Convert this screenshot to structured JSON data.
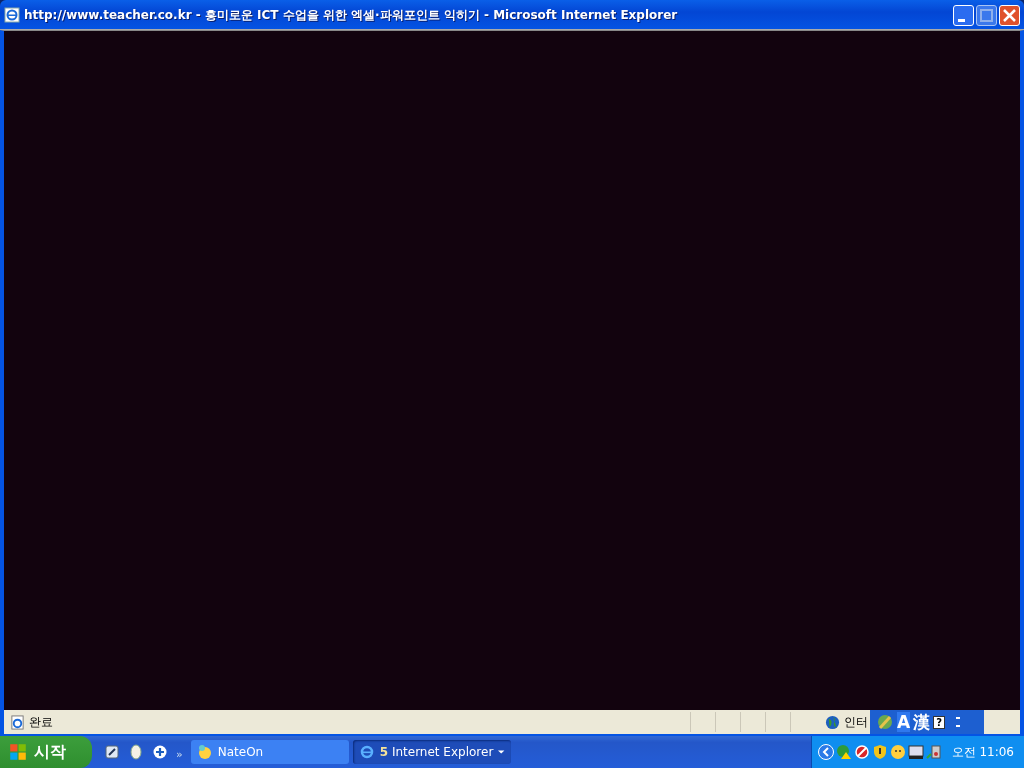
{
  "window": {
    "title": "http://www.teacher.co.kr - 흥미로운 ICT 수업을 위한 엑셀·파워포인트 익히기 - Microsoft Internet Explorer"
  },
  "status_bar": {
    "text": "완료",
    "zone": "인터"
  },
  "ime_bar": {
    "mode": "A",
    "hanja": "漢",
    "help": "?"
  },
  "taskbar": {
    "start": "시작",
    "more": "»",
    "tasks": [
      {
        "label": "NateOn",
        "selected": false
      },
      {
        "label": "Internet Explorer",
        "count": "5",
        "selected": true
      }
    ],
    "clock": "오전 11:06"
  }
}
